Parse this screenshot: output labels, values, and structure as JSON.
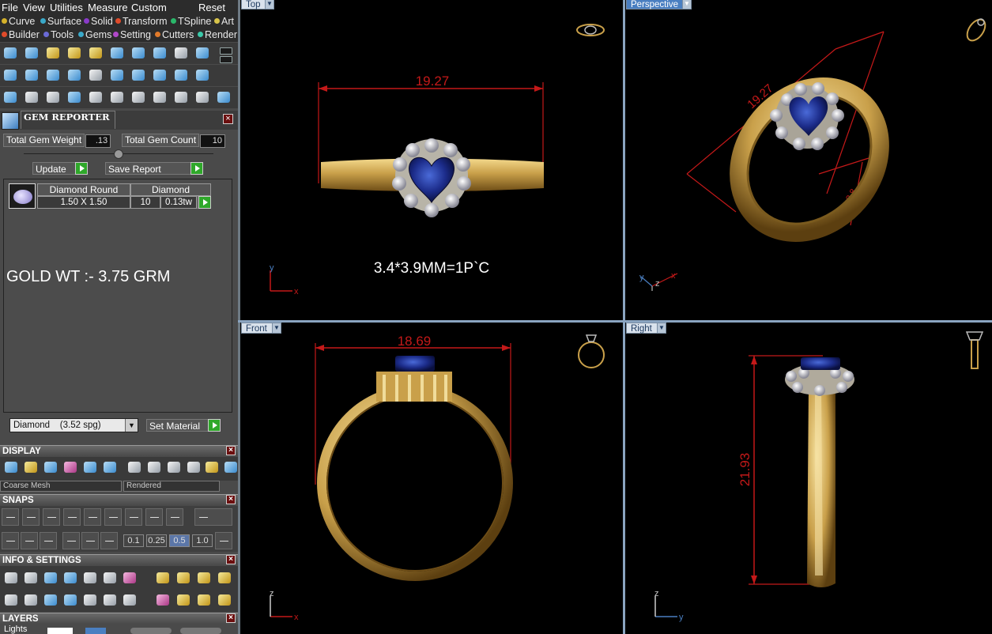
{
  "menubar": {
    "items": [
      "File",
      "View",
      "Utilities",
      "Measure",
      "Custom"
    ],
    "reset": "Reset"
  },
  "categories": {
    "row1": [
      {
        "label": "Curve",
        "color": "#d4b12a"
      },
      {
        "label": "Surface",
        "color": "#3aa9c9"
      },
      {
        "label": "Solid",
        "color": "#8a3bc9"
      },
      {
        "label": "Transform",
        "color": "#e04b2a"
      },
      {
        "label": "TSpline",
        "color": "#2ab86a"
      },
      {
        "label": "Art",
        "color": "#d8c44a"
      }
    ],
    "row2": [
      {
        "label": "Builder",
        "color": "#e04b2a"
      },
      {
        "label": "Tools",
        "color": "#6a6ad6"
      },
      {
        "label": "Gems",
        "color": "#3aa9c9"
      },
      {
        "label": "Setting",
        "color": "#b048c9"
      },
      {
        "label": "Cutters",
        "color": "#e07a2a"
      },
      {
        "label": "Render",
        "color": "#3ac9a9"
      }
    ]
  },
  "gem_reporter": {
    "title": "GEM REPORTER",
    "total_gem_weight_label": "Total Gem Weight",
    "total_gem_weight": ".13",
    "total_gem_count_label": "Total Gem Count",
    "total_gem_count": "10",
    "update_label": "Update",
    "save_report_label": "Save Report",
    "table_headers": [
      "Diamond Round",
      "Diamond"
    ],
    "row": {
      "size": "1.50 X 1.50",
      "count": "10",
      "weight": "0.13tw"
    },
    "note": "GOLD WT :- 3.75 GRM"
  },
  "material": {
    "selected": "Diamond    (3.52 spg)",
    "set_label": "Set Material"
  },
  "display": {
    "title": "DISPLAY",
    "mesh_mode": "Coarse Mesh",
    "render_mode": "Rendered"
  },
  "snaps": {
    "title": "SNAPS",
    "values": [
      "0.1",
      "0.25",
      "0.5",
      "1.0"
    ],
    "selected": "0.5"
  },
  "info_settings": {
    "title": "INFO & SETTINGS"
  },
  "layers": {
    "title": "LAYERS",
    "lights_label": "Lights"
  },
  "viewports": {
    "top": {
      "label": "Top",
      "dimension": "19.27",
      "note": "3.4*3.9MM=1P`C",
      "axis_x": "x",
      "axis_y": "y"
    },
    "perspective": {
      "label": "Perspective",
      "dimension": "19.27",
      "dimension2": "2.8",
      "axis_x": "x",
      "axis_y": "y",
      "axis_z": "z"
    },
    "front": {
      "label": "Front",
      "dimension": "18.69",
      "axis_x": "x",
      "axis_z": "z"
    },
    "right": {
      "label": "Right",
      "dimension": "21.93",
      "axis_y": "y",
      "axis_z": "z"
    }
  },
  "colors": {
    "dimension": "#c41919",
    "gold": "#c9a04a",
    "sapphire": "#1c2c8a",
    "viewport_tab": "#d9e2ec",
    "perspective_tab": "#4a7fc1"
  }
}
